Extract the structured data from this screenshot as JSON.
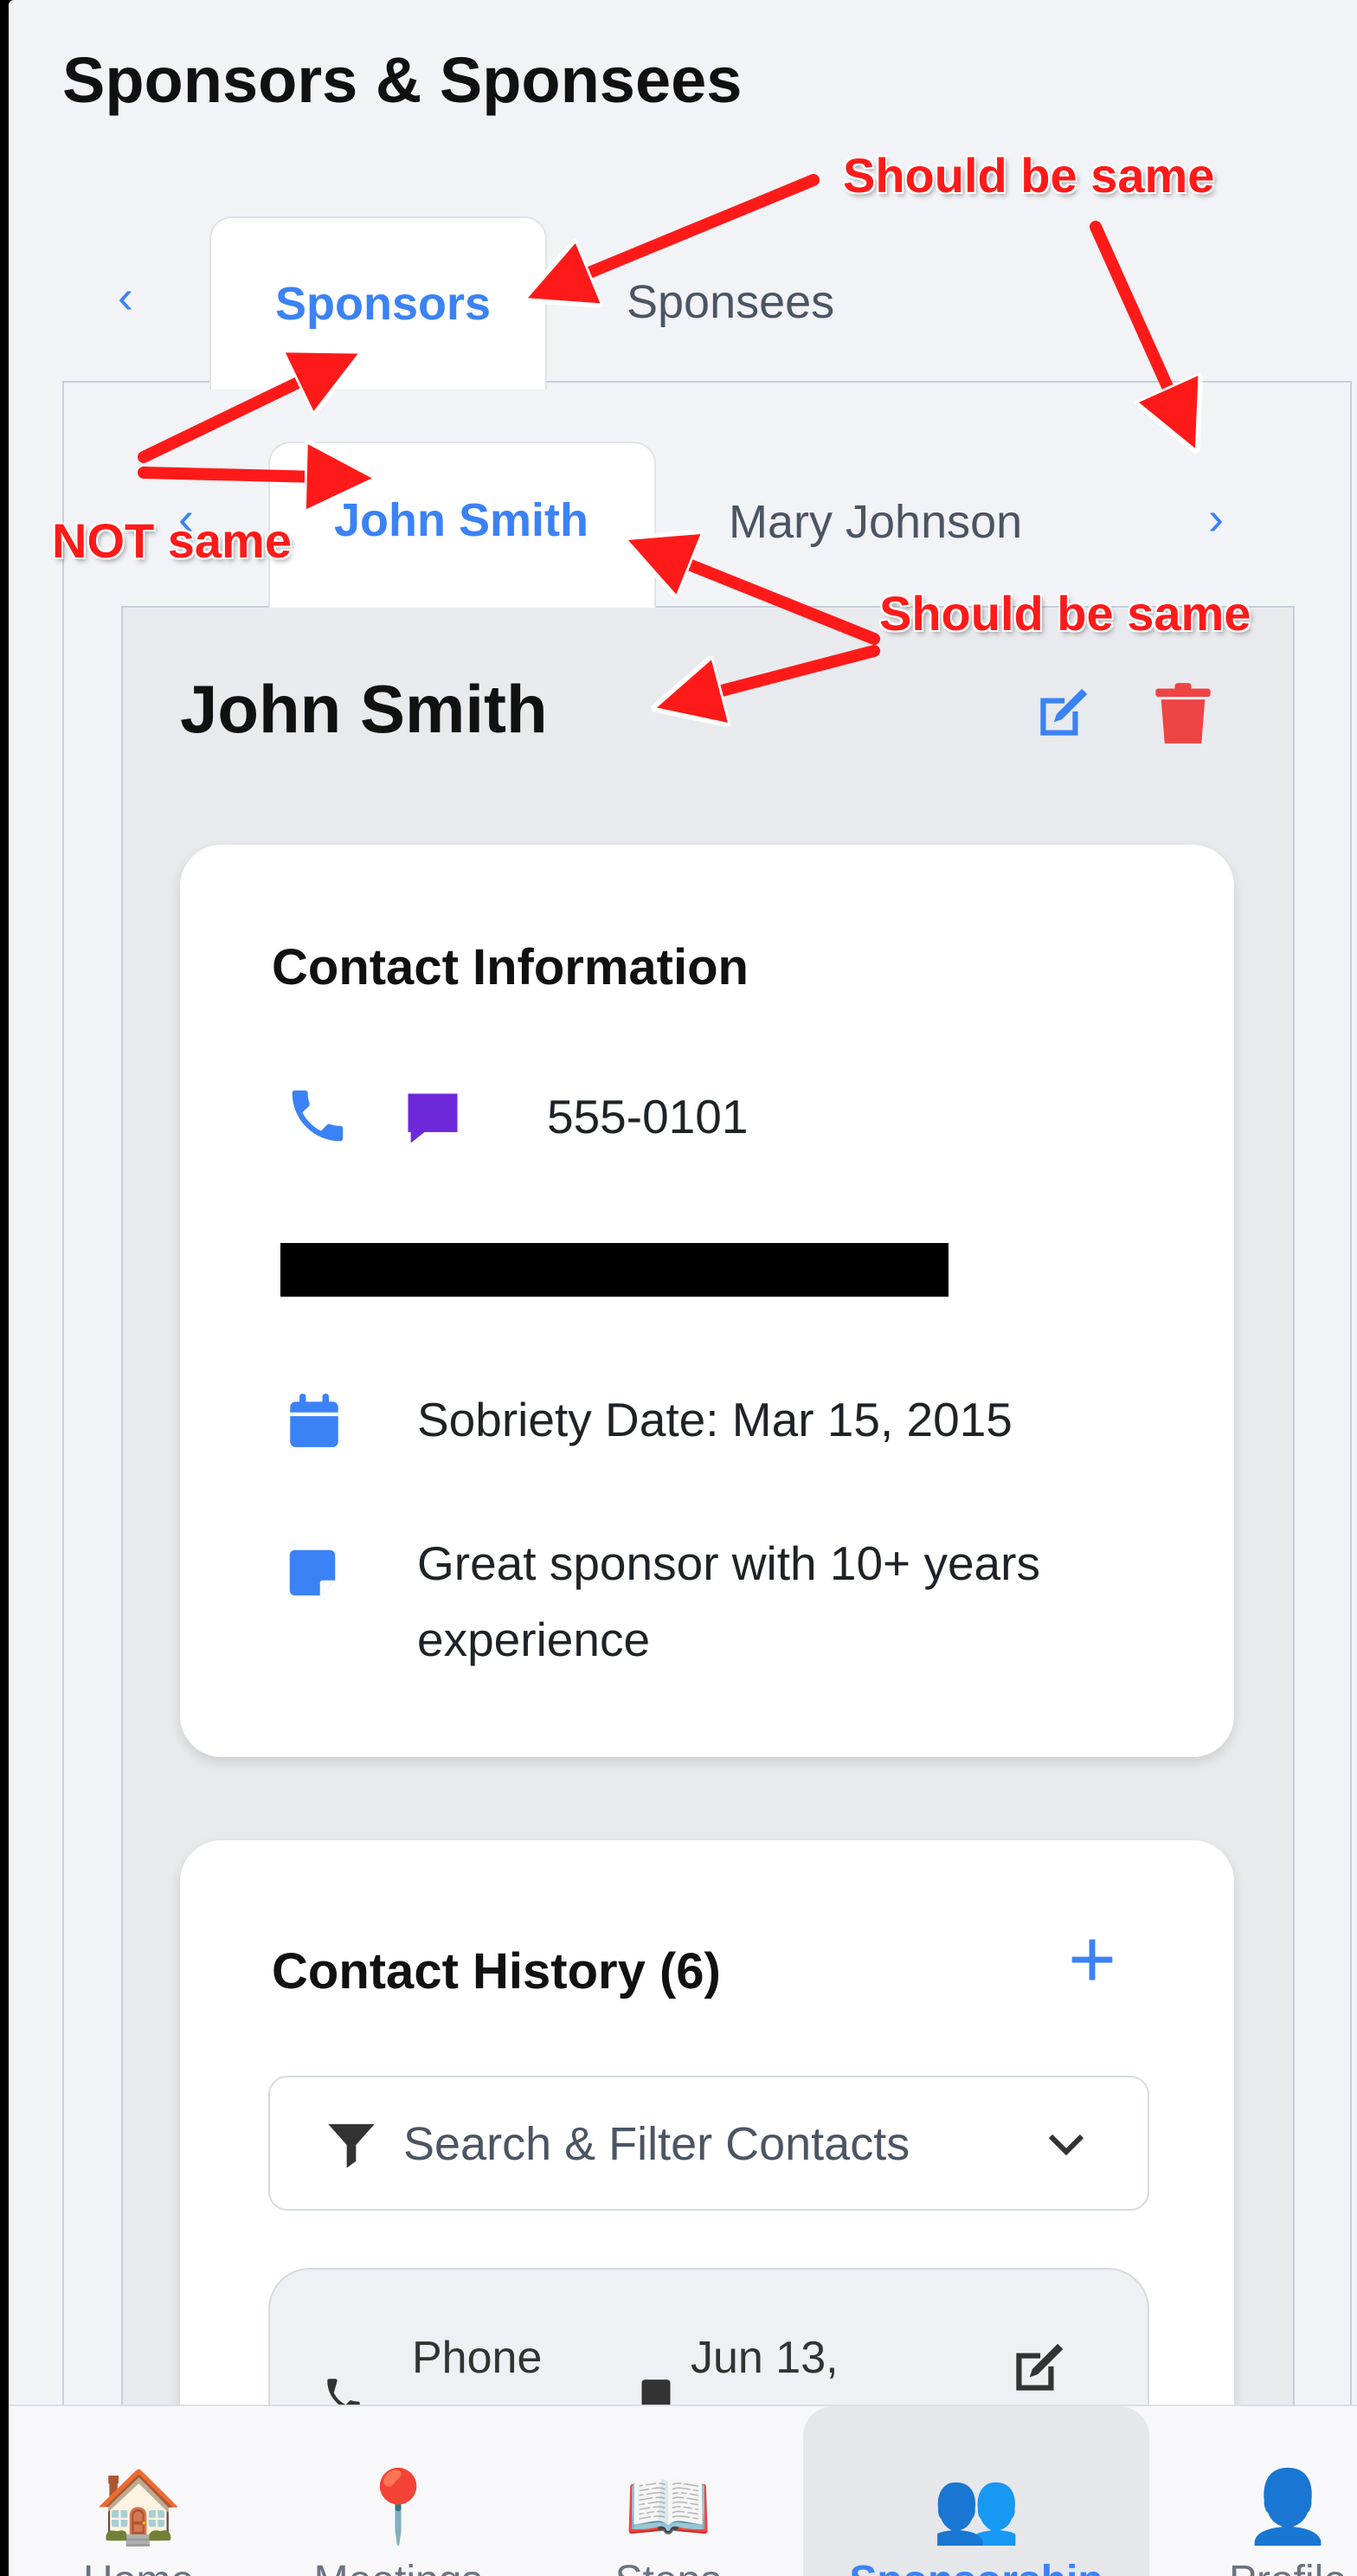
{
  "page": {
    "title": "Sponsors & Sponsees"
  },
  "outer_tabs": {
    "items": [
      {
        "label": "Sponsors",
        "active": true
      },
      {
        "label": "Sponsees",
        "active": false
      }
    ]
  },
  "inner_tabs": {
    "items": [
      {
        "label": "John Smith",
        "active": true
      },
      {
        "label": "Mary Johnson",
        "active": false
      }
    ]
  },
  "detail": {
    "name": "John Smith"
  },
  "contact_info": {
    "title": "Contact Information",
    "phone": "555-0101",
    "sobriety": "Sobriety Date: Mar 15, 2015",
    "notes": "Great sponsor with 10+ years experience"
  },
  "history": {
    "title": "Contact History (6)",
    "add_label": "+",
    "filter_label": "Search & Filter Contacts",
    "entry": {
      "type": "Phone",
      "date": "Jun 13,"
    }
  },
  "nav": {
    "items": [
      {
        "icon": "🏠",
        "label": "Home",
        "active": false
      },
      {
        "icon": "📍",
        "label": "Meetings",
        "active": false
      },
      {
        "icon": "📖",
        "label": "Steps",
        "active": false
      },
      {
        "icon": "👥",
        "label": "Sponsorship",
        "active": true
      },
      {
        "icon": "👤",
        "label": "Profile",
        "active": false
      }
    ]
  },
  "annotations": {
    "top": "Should be same",
    "left": "NOT same",
    "middle": "Should be same"
  },
  "colors": {
    "accent": "#3b82f6",
    "danger": "#ef4444",
    "purple": "#6d28d9",
    "annotation": "#ff1a1a"
  }
}
